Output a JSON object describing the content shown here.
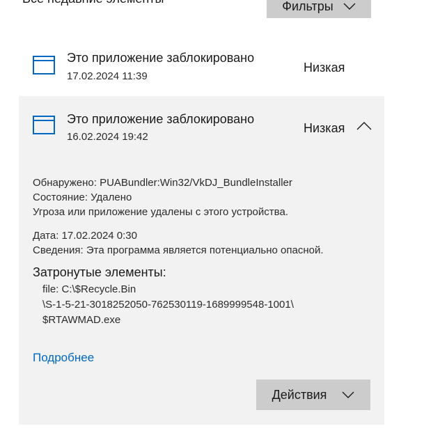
{
  "header": {
    "recent_title": "Все недавние элементы",
    "filters_label": "Фильтры"
  },
  "entries": [
    {
      "title": "Это приложение заблокировано",
      "date": "17.02.2024 11:39",
      "severity": "Низкая",
      "icon": "app-window-icon"
    },
    {
      "title": "Это приложение заблокировано",
      "date": "16.02.2024 19:42",
      "severity": "Низкая",
      "icon": "app-window-icon",
      "details": {
        "detected": "Обнаружено: PUABundler:Win32/VkDJ_BundleInstaller",
        "status": "Состояние:  Удалено",
        "status_desc": "Угроза или приложение удалены с этого устройства.",
        "date": "Дата: 17.02.2024 0:30",
        "info": "Сведения:  Эта программа является потенциально опасной.",
        "affected_title": "Затронутые элементы:",
        "affected_lines": [
          "file: C:\\$Recycle.Bin",
          "\\S-1-5-21-3018252050-762530119-1689999548-1001\\",
          "$RTAWMAD.exe"
        ],
        "more_link": "Подробнее",
        "actions_label": "Действия"
      }
    }
  ],
  "colors": {
    "accent": "#0067c0",
    "icon": "#0067c0",
    "button_bg": "#cccccc",
    "expanded_bg": "#f2f2f2"
  }
}
